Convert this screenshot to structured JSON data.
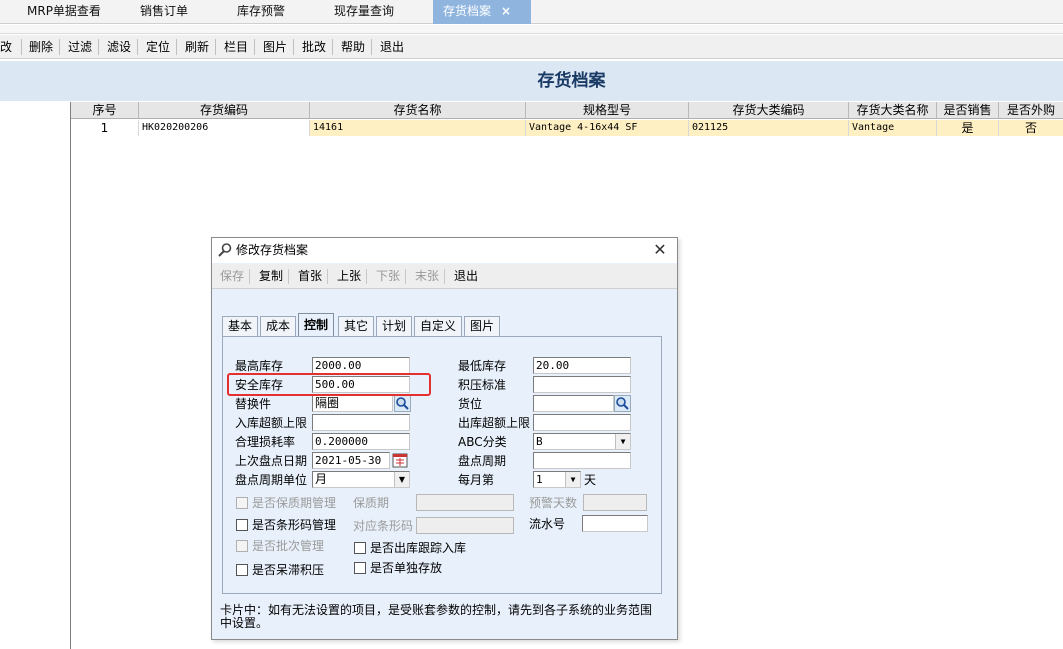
{
  "tabs": [
    {
      "label": "MRP单据查看"
    },
    {
      "label": "销售订单"
    },
    {
      "label": "库存预警"
    },
    {
      "label": "现存量查询"
    },
    {
      "label": "存货档案",
      "close": "×"
    }
  ],
  "toolbar": {
    "items": [
      "改",
      "删除",
      "过滤",
      "滤设",
      "定位",
      "刷新",
      "栏目",
      "图片",
      "批改",
      "帮助",
      "退出"
    ]
  },
  "page_title": "存货档案",
  "grid": {
    "headers": [
      "序号",
      "存货编码",
      "存货名称",
      "规格型号",
      "存货大类编码",
      "存货大类名称",
      "是否销售",
      "是否外购"
    ],
    "rows": [
      [
        "1",
        "HK020200206",
        "14161",
        "Vantage 4-16x44 SF",
        "021125",
        "Vantage",
        "是",
        "否"
      ]
    ]
  },
  "dialog": {
    "title": "修改存货档案",
    "close": "✕",
    "toolbar": [
      "保存",
      "复制",
      "首张",
      "上张",
      "下张",
      "末张",
      "退出"
    ],
    "tabs": [
      "基本",
      "成本",
      "控制",
      "其它",
      "计划",
      "自定义",
      "图片"
    ],
    "fields": {
      "max_stock": {
        "label": "最高库存",
        "value": "2000.00"
      },
      "min_stock": {
        "label": "最低库存",
        "value": "20.00"
      },
      "safety_stock": {
        "label": "安全库存",
        "value": "500.00"
      },
      "overstock_std": {
        "label": "积压标准",
        "value": ""
      },
      "substitute": {
        "label": "替换件",
        "value": "隔圈"
      },
      "location": {
        "label": "货位",
        "value": ""
      },
      "in_limit": {
        "label": "入库超额上限",
        "value": ""
      },
      "out_limit": {
        "label": "出库超额上限",
        "value": ""
      },
      "loss_rate": {
        "label": "合理损耗率",
        "value": "0.200000"
      },
      "abc": {
        "label": "ABC分类",
        "value": "B"
      },
      "last_count_date": {
        "label": "上次盘点日期",
        "value": "2021-05-30"
      },
      "count_cycle": {
        "label": "盘点周期",
        "value": ""
      },
      "cycle_unit": {
        "label": "盘点周期单位",
        "value": "月"
      },
      "monthly_day": {
        "label": "每月第",
        "value": "1",
        "suffix": "天"
      },
      "shelf_life_mgmt": {
        "label": "是否保质期管理"
      },
      "shelf_life": {
        "label": "保质期",
        "value": ""
      },
      "warn_days": {
        "label": "预警天数",
        "value": ""
      },
      "barcode_mgmt": {
        "label": "是否条形码管理"
      },
      "barcode": {
        "label": "对应条形码",
        "value": ""
      },
      "serial_no": {
        "label": "流水号",
        "value": ""
      },
      "batch_mgmt": {
        "label": "是否批次管理"
      },
      "track_in": {
        "label": "是否出库跟踪入库"
      },
      "slow_moving": {
        "label": "是否呆滞积压"
      },
      "separate_store": {
        "label": "是否单独存放"
      }
    },
    "note": "卡片中：如有无法设置的项目，是受账套参数的控制，请先到各子系统的业务范围中设置。"
  },
  "colors": {
    "active_tab": "#8fb5df",
    "title_band": "#dbe7f3",
    "highlight_row": "#fff0c4",
    "annotation": "#e53030"
  }
}
